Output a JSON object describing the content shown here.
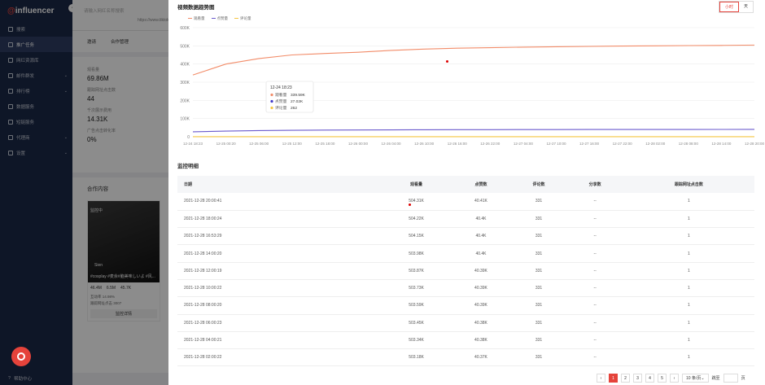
{
  "sidebar": {
    "logo": "influencer",
    "logo_mark": "@",
    "items": [
      {
        "label": "搜索",
        "icon": "search-icon"
      },
      {
        "label": "推广任务",
        "icon": "task-icon",
        "active": true
      },
      {
        "label": "网红资源库",
        "icon": "library-icon"
      },
      {
        "label": "邮件群发",
        "icon": "mail-icon",
        "chev": true
      },
      {
        "label": "排行榜",
        "icon": "rank-icon",
        "chev": true
      },
      {
        "label": "数据服务",
        "icon": "data-icon"
      },
      {
        "label": "短链服务",
        "icon": "link-icon"
      },
      {
        "label": "代理商",
        "icon": "agent-icon",
        "chev": true
      },
      {
        "label": "设置",
        "icon": "gear-icon",
        "chev": true
      }
    ],
    "help": "帮助中心"
  },
  "bg": {
    "search_placeholder": "请输入网红名称搜索",
    "url": "https://www.tiktok.",
    "tabs": [
      "邀请",
      "合作管理"
    ],
    "stats": [
      {
        "label": "观看量",
        "value": "69.86M"
      },
      {
        "label": "跟踪网址点击数",
        "value": "44"
      },
      {
        "label": "千次展示费用",
        "value": "14.31K"
      },
      {
        "label": "广告点击转化率",
        "value": "0%"
      }
    ],
    "works_title": "合作内容",
    "card": {
      "tag": "监控中",
      "name": "Sien",
      "caption": "#cosplay #麦余#脑美味しいよ #风...",
      "views": "46.4M",
      "likes": "6.5M",
      "comments": "45.7K",
      "row1": "互动率",
      "row1v": "14.98%",
      "row2": "跟踪网址点击",
      "row2v": "3007",
      "button": "监控详情"
    }
  },
  "panel": {
    "title": "视频数据趋势图",
    "toggle": [
      "小时",
      "天"
    ],
    "legend": [
      {
        "name": "观看量",
        "color": "#f28c69"
      },
      {
        "name": "点赞量",
        "color": "#6a5acd"
      },
      {
        "name": "评论量",
        "color": "#f5c542"
      }
    ],
    "tooltip": {
      "time": "12-24 18:23",
      "rows": [
        {
          "name": "观看量",
          "value": "339.59K",
          "color": "#f28c69"
        },
        {
          "name": "点赞量",
          "value": "27.02K",
          "color": "#3e37c8"
        },
        {
          "name": "评论量",
          "value": "262",
          "color": "#f5c542"
        }
      ]
    },
    "section": "监控明细",
    "columns": [
      "日期",
      "观看量",
      "点赞数",
      "评论数",
      "分享数",
      "跟踪网址点击数"
    ],
    "rows": [
      [
        "2021-12-28 20:00:41",
        "504.31K",
        "40.41K",
        "331",
        "--",
        "1"
      ],
      [
        "2021-12-28 18:00:24",
        "504.22K",
        "40.4K",
        "331",
        "--",
        "1"
      ],
      [
        "2021-12-28 16:53:29",
        "504.15K",
        "40.4K",
        "331",
        "--",
        "1"
      ],
      [
        "2021-12-28 14:00:20",
        "503.98K",
        "40.4K",
        "331",
        "--",
        "1"
      ],
      [
        "2021-12-28 12:00:19",
        "503.87K",
        "40.39K",
        "331",
        "--",
        "1"
      ],
      [
        "2021-12-28 10:00:22",
        "503.73K",
        "40.39K",
        "331",
        "--",
        "1"
      ],
      [
        "2021-12-28 08:00:20",
        "503.59K",
        "40.39K",
        "331",
        "--",
        "1"
      ],
      [
        "2021-12-28 06:00:23",
        "503.45K",
        "40.38K",
        "331",
        "--",
        "1"
      ],
      [
        "2021-12-28 04:00:21",
        "503.34K",
        "40.38K",
        "331",
        "--",
        "1"
      ],
      [
        "2021-12-28 02:00:22",
        "503.18K",
        "40.37K",
        "331",
        "--",
        "1"
      ]
    ],
    "pager": {
      "pages": [
        "1",
        "2",
        "3",
        "4",
        "5"
      ],
      "current": "1",
      "page_size": "10 条/页",
      "jump": "跳至",
      "unit": "页"
    }
  },
  "chart_data": {
    "type": "line",
    "ylim": [
      0,
      600000
    ],
    "yticks": [
      "0",
      "100K",
      "200K",
      "300K",
      "400K",
      "500K",
      "600K"
    ],
    "x": [
      "12-24 18:23",
      "12-25 00:20",
      "12-25 06:00",
      "12-25 12:00",
      "12-25 18:00",
      "12-26 00:00",
      "12-26 04:00",
      "12-26 10:00",
      "12-26 16:00",
      "12-26 22:00",
      "12-27 04:00",
      "12-27 10:00",
      "12-27 16:00",
      "12-27 22:00",
      "12-28 02:00",
      "12-28 08:00",
      "12-28 14:00",
      "12-28 20:00"
    ],
    "series": [
      {
        "name": "观看量",
        "color": "#f28c69",
        "values": [
          339590,
          400000,
          430000,
          450000,
          458000,
          465000,
          475000,
          482000,
          487000,
          490000,
          493000,
          495000,
          497000,
          499000,
          500000,
          501500,
          502500,
          504310
        ]
      },
      {
        "name": "点赞量",
        "color": "#6a5acd",
        "values": [
          27020,
          31000,
          34000,
          35500,
          36500,
          37200,
          37800,
          38300,
          38700,
          39000,
          39300,
          39600,
          39800,
          40000,
          40100,
          40200,
          40300,
          40410
        ]
      },
      {
        "name": "评论量",
        "color": "#f5c542",
        "values": [
          262,
          280,
          295,
          305,
          312,
          318,
          322,
          325,
          327,
          328,
          329,
          330,
          330,
          331,
          331,
          331,
          331,
          331
        ]
      }
    ]
  }
}
